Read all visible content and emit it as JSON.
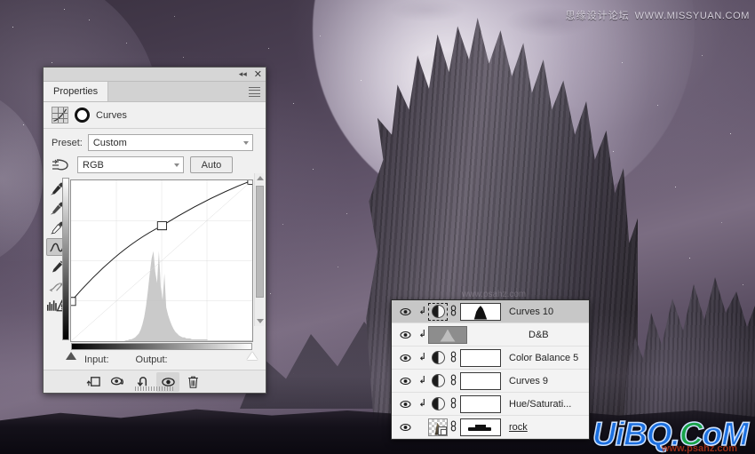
{
  "watermarks": {
    "top_cn": "思缘设计论坛",
    "top_url": "WWW.MISSYUAN.COM",
    "bottom_u": "UiBQ",
    "bottom_dot": ".",
    "bottom_c": "C",
    "bottom_om": "oM",
    "bottom_sub": "www.psahz.com",
    "mid": "www.psahz.com"
  },
  "properties_panel": {
    "title_tab": "Properties",
    "collapse_icon": "collapse-double-arrow-icon",
    "close_icon": "close-icon",
    "menu_icon": "panel-menu-icon",
    "adjustment_name": "Curves",
    "adjustment_icon": "curves-grid-icon",
    "mask_icon": "layer-mask-icon",
    "preset_label": "Preset:",
    "preset_value": "Custom",
    "channel_value": "RGB",
    "auto_label": "Auto",
    "onimage_icon": "on-image-adjust-icon",
    "input_label": "Input:",
    "output_label": "Output:",
    "input_value": "",
    "output_value": "",
    "tools": [
      {
        "name": "eyedropper-black-point-icon",
        "selected": false
      },
      {
        "name": "eyedropper-gray-point-icon",
        "selected": false
      },
      {
        "name": "eyedropper-white-point-icon",
        "selected": false
      },
      {
        "name": "curve-point-tool-icon",
        "selected": true
      },
      {
        "name": "pencil-draw-tool-icon",
        "selected": false
      },
      {
        "name": "smooth-curve-icon",
        "selected": false
      },
      {
        "name": "histogram-warning-icon",
        "selected": false
      }
    ],
    "bottom_buttons": [
      {
        "name": "clip-to-layer-button",
        "icon": "clip-to-layer-icon",
        "active": false
      },
      {
        "name": "toggle-previous-state-button",
        "icon": "eye-rotate-icon",
        "active": false
      },
      {
        "name": "reset-adjustment-button",
        "icon": "reset-arrow-icon",
        "active": false
      },
      {
        "name": "toggle-layer-visibility-button",
        "icon": "eye-icon",
        "active": true
      },
      {
        "name": "delete-adjustment-button",
        "icon": "trash-icon",
        "active": false
      }
    ]
  },
  "chart_data": {
    "type": "line",
    "title": "Curves RGB",
    "xlabel": "Input",
    "ylabel": "Output",
    "xlim": [
      0,
      255
    ],
    "ylim": [
      0,
      255
    ],
    "grid": true,
    "grid_divisions": 4,
    "series": [
      {
        "name": "RGB curve",
        "points": [
          [
            0,
            63
          ],
          [
            128,
            183
          ],
          [
            255,
            255
          ]
        ]
      },
      {
        "name": "baseline diagonal",
        "points": [
          [
            0,
            0
          ],
          [
            255,
            255
          ]
        ]
      }
    ],
    "histogram": {
      "name": "Input histogram",
      "bins": [
        0,
        0,
        0,
        0,
        0,
        0,
        0,
        0,
        0,
        0,
        0,
        0,
        0,
        0,
        0,
        0,
        0,
        0,
        0,
        0,
        0,
        0,
        0,
        0,
        0,
        0,
        0,
        0,
        0,
        0,
        1,
        1,
        2,
        2,
        3,
        4,
        6,
        8,
        12,
        18,
        26,
        38,
        54,
        72,
        88,
        96,
        74,
        62,
        96,
        58,
        44,
        72,
        36,
        28,
        22,
        17,
        13,
        10,
        8,
        6,
        5,
        4,
        4,
        3,
        3,
        3,
        2,
        2,
        2,
        2,
        2,
        2,
        2,
        2,
        2,
        1,
        1,
        1,
        1,
        1,
        1,
        1,
        1,
        1,
        1,
        1,
        1,
        1,
        1,
        1,
        1,
        1,
        1,
        1,
        1,
        1,
        1,
        1,
        1,
        1
      ]
    },
    "black_point_handle": 0,
    "white_point_handle": 255
  },
  "layers_panel": {
    "rows": [
      {
        "name": "Curves 10",
        "visible": true,
        "selected": true,
        "clipped": true,
        "linked": true,
        "thumb_type": "adjustment",
        "mask_type": "mountain",
        "eye_icon": "eye-icon",
        "clip_icon": "clipping-mask-icon",
        "link_icon": "link-icon"
      },
      {
        "name": "D&B",
        "visible": true,
        "selected": false,
        "clipped": true,
        "linked": false,
        "thumb_type": "gray-pixel",
        "mask_type": "none",
        "eye_icon": "eye-icon",
        "clip_icon": "clipping-mask-icon",
        "link_icon": ""
      },
      {
        "name": "Color Balance 5",
        "visible": true,
        "selected": false,
        "clipped": true,
        "linked": true,
        "thumb_type": "adjustment",
        "mask_type": "empty",
        "eye_icon": "eye-icon",
        "clip_icon": "clipping-mask-icon",
        "link_icon": "link-icon"
      },
      {
        "name": "Curves 9",
        "visible": true,
        "selected": false,
        "clipped": true,
        "linked": true,
        "thumb_type": "adjustment",
        "mask_type": "empty",
        "eye_icon": "eye-icon",
        "clip_icon": "clipping-mask-icon",
        "link_icon": "link-icon"
      },
      {
        "name": "Hue/Saturati...",
        "visible": true,
        "selected": false,
        "clipped": true,
        "linked": true,
        "thumb_type": "adjustment",
        "mask_type": "empty",
        "eye_icon": "eye-icon",
        "clip_icon": "clipping-mask-icon",
        "link_icon": "link-icon"
      },
      {
        "name": "rock",
        "visible": true,
        "selected": false,
        "clipped": false,
        "linked": true,
        "thumb_type": "smart-object",
        "mask_type": "bar",
        "eye_icon": "eye-icon",
        "clip_icon": "",
        "link_icon": "link-icon"
      }
    ]
  },
  "colors": {
    "panel_bg": "#f0f0f0",
    "panel_tab_bg": "#d2d2d2",
    "selected_row": "#c7c7c7",
    "scene_purple": "#6b5d75",
    "watermark_blue": "#1b6fe0",
    "watermark_green": "#17a348"
  }
}
